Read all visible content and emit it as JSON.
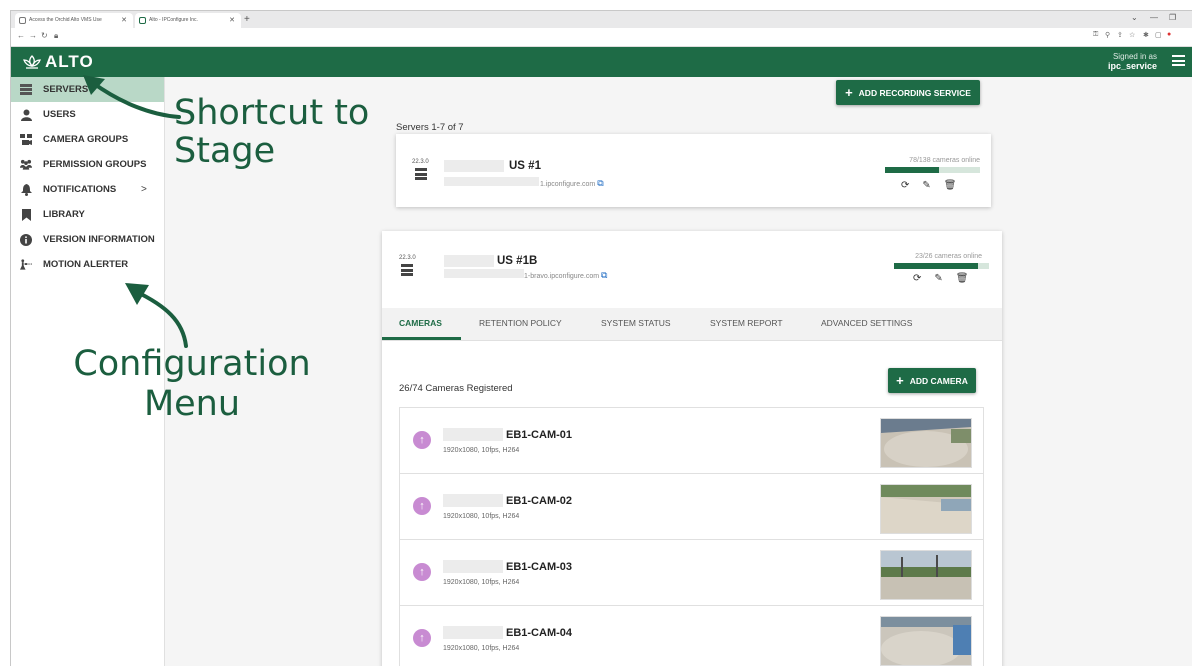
{
  "browser": {
    "tabs": [
      {
        "title": "Access the Orchid Alto VMS Use"
      },
      {
        "title": "Alto - IPConfigure Inc."
      }
    ],
    "new_tab": "+",
    "address_bar_value": ""
  },
  "app": {
    "logo_text": "ALTO",
    "signed_in_label": "Signed in as",
    "username": "ipc_service"
  },
  "sidebar": {
    "items": [
      {
        "label": "SERVERS",
        "icon": "servers-icon",
        "active": true
      },
      {
        "label": "USERS",
        "icon": "user-icon"
      },
      {
        "label": "CAMERA GROUPS",
        "icon": "camera-groups-icon"
      },
      {
        "label": "PERMISSION GROUPS",
        "icon": "permission-groups-icon"
      },
      {
        "label": "NOTIFICATIONS",
        "icon": "bell-icon",
        "has_submenu": true
      },
      {
        "label": "LIBRARY",
        "icon": "bookmark-icon"
      },
      {
        "label": "VERSION INFORMATION",
        "icon": "info-icon"
      },
      {
        "label": "MOTION ALERTER",
        "icon": "motion-alerter-icon"
      }
    ]
  },
  "main": {
    "add_recording_service_label": "ADD RECORDING SERVICE",
    "servers_count": "Servers 1-7 of 7",
    "servers": [
      {
        "version": "22.3.0",
        "name": "US #1",
        "url": "1.ipconfigure.com",
        "online_text": "78/138 cameras online",
        "online_fraction": 0.57
      },
      {
        "version": "22.3.0",
        "name": "US #1B",
        "url": "1-bravo.ipconfigure.com",
        "online_text": "23/26 cameras online",
        "online_fraction": 0.88
      }
    ],
    "tabs": [
      "CAMERAS",
      "RETENTION POLICY",
      "SYSTEM STATUS",
      "SYSTEM REPORT",
      "ADVANCED SETTINGS"
    ],
    "registered_text": "26/74 Cameras Registered",
    "add_camera_label": "ADD CAMERA",
    "cameras": [
      {
        "name": "EB1-CAM-01",
        "info": "1920x1080, 10fps, H264"
      },
      {
        "name": "EB1-CAM-02",
        "info": "1920x1080, 10fps, H264"
      },
      {
        "name": "EB1-CAM-03",
        "info": "1920x1080, 10fps, H264"
      },
      {
        "name": "EB1-CAM-04",
        "info": "1920x1080, 10fps, H264"
      }
    ]
  },
  "annotations": {
    "shortcut": [
      "Shortcut to",
      "Stage"
    ],
    "config": [
      "Configuration",
      "Menu"
    ],
    "color": "#1b5e3f"
  },
  "colors": {
    "brand_green": "#1e6b46",
    "active_sidebar": "#b9d8c7",
    "camera_status": "#c88bd2",
    "link_blue": "#1565c0"
  }
}
